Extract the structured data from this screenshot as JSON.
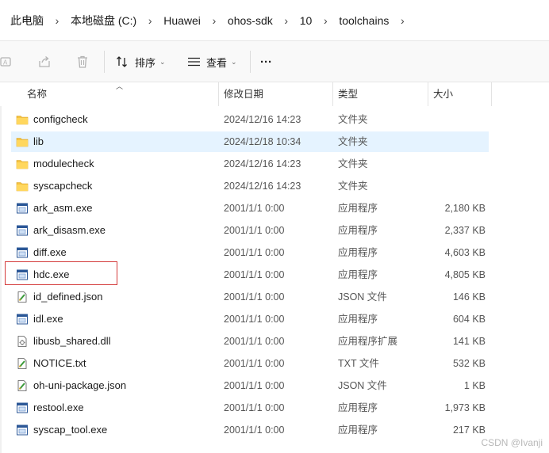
{
  "breadcrumb": {
    "items": [
      "此电脑",
      "本地磁盘 (C:)",
      "Huawei",
      "ohos-sdk",
      "10",
      "toolchains"
    ],
    "separator": "›"
  },
  "toolbar": {
    "sort_label": "排序",
    "view_label": "查看",
    "more_label": "···"
  },
  "columns": {
    "name": "名称",
    "modified": "修改日期",
    "type": "类型",
    "size": "大小"
  },
  "files": [
    {
      "name": "configcheck",
      "modified": "2024/12/16 14:23",
      "type": "文件夹",
      "size": "",
      "icon": "folder-icon"
    },
    {
      "name": "lib",
      "modified": "2024/12/18 10:34",
      "type": "文件夹",
      "size": "",
      "icon": "folder-icon"
    },
    {
      "name": "modulecheck",
      "modified": "2024/12/16 14:23",
      "type": "文件夹",
      "size": "",
      "icon": "folder-icon"
    },
    {
      "name": "syscapcheck",
      "modified": "2024/12/16 14:23",
      "type": "文件夹",
      "size": "",
      "icon": "folder-icon"
    },
    {
      "name": "ark_asm.exe",
      "modified": "2001/1/1 0:00",
      "type": "应用程序",
      "size": "2,180 KB",
      "icon": "exe-icon"
    },
    {
      "name": "ark_disasm.exe",
      "modified": "2001/1/1 0:00",
      "type": "应用程序",
      "size": "2,337 KB",
      "icon": "exe-icon"
    },
    {
      "name": "diff.exe",
      "modified": "2001/1/1 0:00",
      "type": "应用程序",
      "size": "4,603 KB",
      "icon": "exe-icon"
    },
    {
      "name": "hdc.exe",
      "modified": "2001/1/1 0:00",
      "type": "应用程序",
      "size": "4,805 KB",
      "icon": "exe-icon"
    },
    {
      "name": "id_defined.json",
      "modified": "2001/1/1 0:00",
      "type": "JSON 文件",
      "size": "146 KB",
      "icon": "json-icon"
    },
    {
      "name": "idl.exe",
      "modified": "2001/1/1 0:00",
      "type": "应用程序",
      "size": "604 KB",
      "icon": "exe-icon"
    },
    {
      "name": "libusb_shared.dll",
      "modified": "2001/1/1 0:00",
      "type": "应用程序扩展",
      "size": "141 KB",
      "icon": "dll-icon"
    },
    {
      "name": "NOTICE.txt",
      "modified": "2001/1/1 0:00",
      "type": "TXT 文件",
      "size": "532 KB",
      "icon": "txt-icon"
    },
    {
      "name": "oh-uni-package.json",
      "modified": "2001/1/1 0:00",
      "type": "JSON 文件",
      "size": "1 KB",
      "icon": "json-icon"
    },
    {
      "name": "restool.exe",
      "modified": "2001/1/1 0:00",
      "type": "应用程序",
      "size": "1,973 KB",
      "icon": "exe-icon"
    },
    {
      "name": "syscap_tool.exe",
      "modified": "2001/1/1 0:00",
      "type": "应用程序",
      "size": "217 KB",
      "icon": "exe-icon"
    }
  ],
  "selected_index": 1,
  "highlighted_file": "hdc.exe",
  "watermark": "CSDN @Ivanji",
  "colors": {
    "selection_bg": "#e5f3ff",
    "highlight_border": "#d43a3a",
    "folder": "#f5c342"
  }
}
